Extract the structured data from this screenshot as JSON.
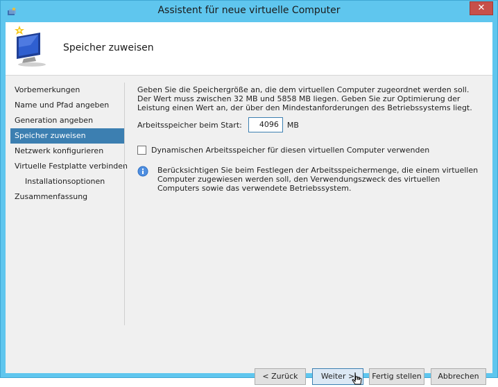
{
  "window": {
    "title": "Assistent für neue virtuelle Computer",
    "close_label": "✕"
  },
  "header": {
    "title": "Speicher zuweisen"
  },
  "nav": {
    "items": [
      {
        "label": "Vorbemerkungen",
        "active": false,
        "sub": false
      },
      {
        "label": "Name und Pfad angeben",
        "active": false,
        "sub": false
      },
      {
        "label": "Generation angeben",
        "active": false,
        "sub": false
      },
      {
        "label": "Speicher zuweisen",
        "active": true,
        "sub": false
      },
      {
        "label": "Netzwerk konfigurieren",
        "active": false,
        "sub": false
      },
      {
        "label": "Virtuelle Festplatte verbinden",
        "active": false,
        "sub": false
      },
      {
        "label": "Installationsoptionen",
        "active": false,
        "sub": true
      },
      {
        "label": "Zusammenfassung",
        "active": false,
        "sub": false
      }
    ]
  },
  "content": {
    "description": "Geben Sie die Speichergröße an, die dem virtuellen Computer zugeordnet werden soll. Der Wert muss zwischen 32 MB und 5858 MB liegen. Geben Sie zur Optimierung der Leistung einen Wert an, der über den Mindestanforderungen des Betriebssystems liegt.",
    "memory_label": "Arbeitsspeicher beim Start:",
    "memory_value": "4096",
    "memory_unit": "MB",
    "dynamic_memory_label": "Dynamischen Arbeitsspeicher für diesen virtuellen Computer verwenden",
    "dynamic_memory_checked": false,
    "info_text": "Berücksichtigen Sie beim Festlegen der Arbeitsspeichermenge, die einem virtuellen Computer zugewiesen werden soll, den Verwendungszweck des virtuellen Computers sowie das verwendete Betriebssystem."
  },
  "buttons": {
    "back": "< Zurück",
    "next": "Weiter >",
    "finish": "Fertig stellen",
    "cancel": "Abbrechen"
  },
  "colors": {
    "title_bar": "#5fc6ee",
    "active_nav": "#3c7fb1",
    "close_button": "#c7504a"
  },
  "icons": {
    "app": "hyperv-app-icon",
    "header": "monitor-wizard-icon",
    "info": "info-icon"
  }
}
